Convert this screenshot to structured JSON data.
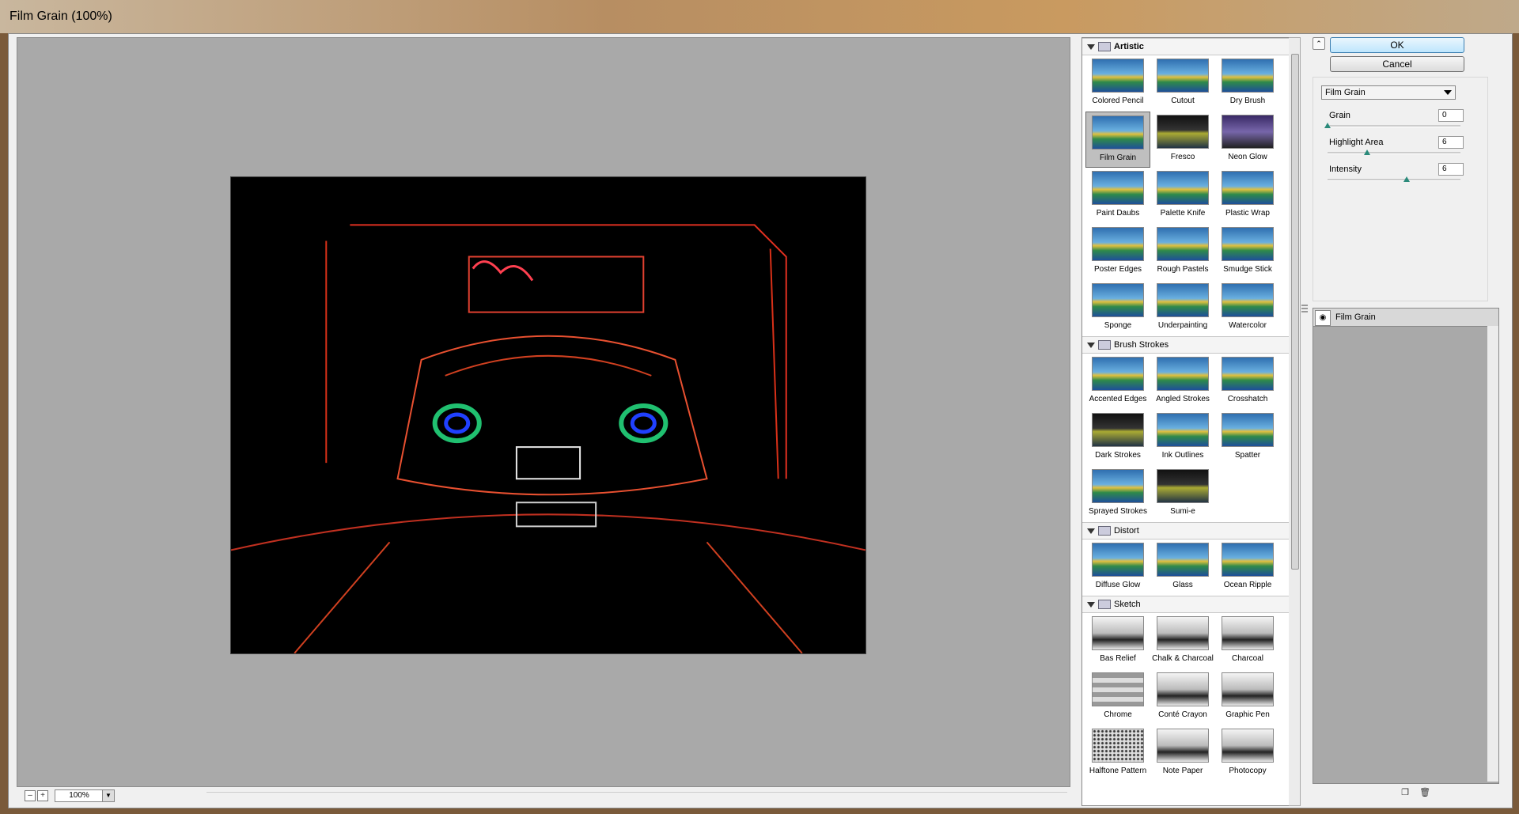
{
  "window": {
    "title": "Film Grain (100%)"
  },
  "zoom": {
    "minus": "–",
    "plus": "+",
    "value": "100%",
    "dropdown": "▼"
  },
  "gallery": {
    "categories": [
      {
        "name": "Artistic",
        "filters": [
          "Colored Pencil",
          "Cutout",
          "Dry Brush",
          "Film Grain",
          "Fresco",
          "Neon Glow",
          "Paint Daubs",
          "Palette Knife",
          "Plastic Wrap",
          "Poster Edges",
          "Rough Pastels",
          "Smudge Stick",
          "Sponge",
          "Underpainting",
          "Watercolor"
        ]
      },
      {
        "name": "Brush Strokes",
        "filters": [
          "Accented Edges",
          "Angled Strokes",
          "Crosshatch",
          "Dark Strokes",
          "Ink Outlines",
          "Spatter",
          "Sprayed Strokes",
          "Sumi-e"
        ]
      },
      {
        "name": "Distort",
        "filters": [
          "Diffuse Glow",
          "Glass",
          "Ocean Ripple"
        ]
      },
      {
        "name": "Sketch",
        "filters": [
          "Bas Relief",
          "Chalk & Charcoal",
          "Charcoal",
          "Chrome",
          "Conté Crayon",
          "Graphic Pen",
          "Halftone Pattern",
          "Note Paper",
          "Photocopy"
        ]
      }
    ],
    "selected": "Film Grain"
  },
  "buttons": {
    "ok": "OK",
    "cancel": "Cancel",
    "collapse": "⌃"
  },
  "settings": {
    "filter_select": "Film Grain",
    "params": [
      {
        "label": "Grain",
        "value": "0",
        "fraction": 0.0
      },
      {
        "label": "Highlight Area",
        "value": "6",
        "fraction": 0.3
      },
      {
        "label": "Intensity",
        "value": "6",
        "fraction": 0.6
      }
    ]
  },
  "layers": {
    "items": [
      {
        "name": "Film Grain",
        "visible_icon": "eye-icon"
      }
    ],
    "new_icon": "new-layer-icon",
    "delete_icon": "trash-icon"
  }
}
